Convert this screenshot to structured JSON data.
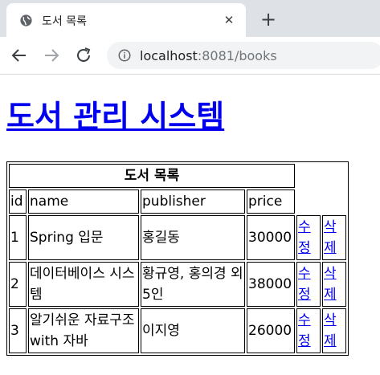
{
  "browser": {
    "tab_title": "도서 목록",
    "tab_close": "✕",
    "new_tab": "+",
    "url_host": "localhost",
    "url_rest": ":8081/books"
  },
  "page": {
    "title": "도서 관리 시스템",
    "table_caption": "도서 목록",
    "columns": [
      "id",
      "name",
      "publisher",
      "price"
    ],
    "rows": [
      {
        "id": "1",
        "name": "Spring 입문",
        "publisher": "홍길동",
        "price": "30000",
        "edit": "수정",
        "delete": "삭제"
      },
      {
        "id": "2",
        "name": "데이터베이스 시스템",
        "publisher": "황규영, 홍의경 외 5인",
        "price": "38000",
        "edit": "수정",
        "delete": "삭제"
      },
      {
        "id": "3",
        "name": "알기쉬운 자료구조 with 자바",
        "publisher": "이지영",
        "price": "26000",
        "edit": "수정",
        "delete": "삭제"
      }
    ]
  },
  "icons": {
    "favicon": "globe-icon",
    "back": "back-arrow-icon",
    "forward": "forward-arrow-icon",
    "reload": "reload-icon",
    "site_info": "info-icon"
  },
  "colors": {
    "tabstrip": "#dee1e6",
    "link": "#0000ee",
    "omnibox": "#f1f3f4"
  }
}
